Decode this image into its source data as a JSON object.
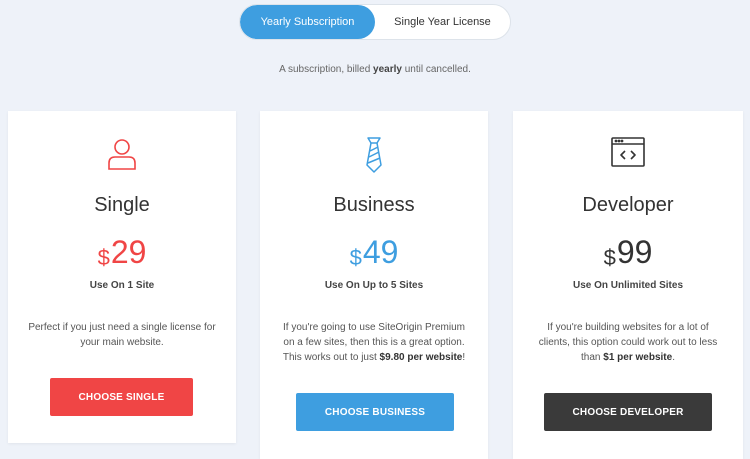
{
  "toggle": {
    "active_label": "Yearly Subscription",
    "inactive_label": "Single Year License"
  },
  "subtitle": {
    "prefix": "A subscription, billed ",
    "bold": "yearly",
    "suffix": " until cancelled."
  },
  "colors": {
    "single": "#f04545",
    "business": "#3e9ee0",
    "developer": "#3a3a3a",
    "background": "#eef2f9"
  },
  "plans": [
    {
      "icon": "user-icon",
      "name": "Single",
      "currency": "$",
      "price": "29",
      "uses": "Use On 1 Site",
      "desc_text": "Perfect if you just need a single license for your main website.",
      "desc_bold": "",
      "desc_end": "",
      "button": "CHOOSE SINGLE"
    },
    {
      "icon": "tie-icon",
      "name": "Business",
      "currency": "$",
      "price": "49",
      "uses": "Use On Up to 5 Sites",
      "desc_text": "If you're going to use SiteOrigin Premium on a few sites, then this is a great option. This works out to just ",
      "desc_bold": "$9.80 per website",
      "desc_end": "!",
      "button": "CHOOSE BUSINESS"
    },
    {
      "icon": "code-window-icon",
      "name": "Developer",
      "currency": "$",
      "price": "99",
      "uses": "Use On Unlimited Sites",
      "desc_text": "If you're building websites for a lot of clients, this option could work out to less than ",
      "desc_bold": "$1 per website",
      "desc_end": ".",
      "button": "CHOOSE DEVELOPER"
    }
  ]
}
